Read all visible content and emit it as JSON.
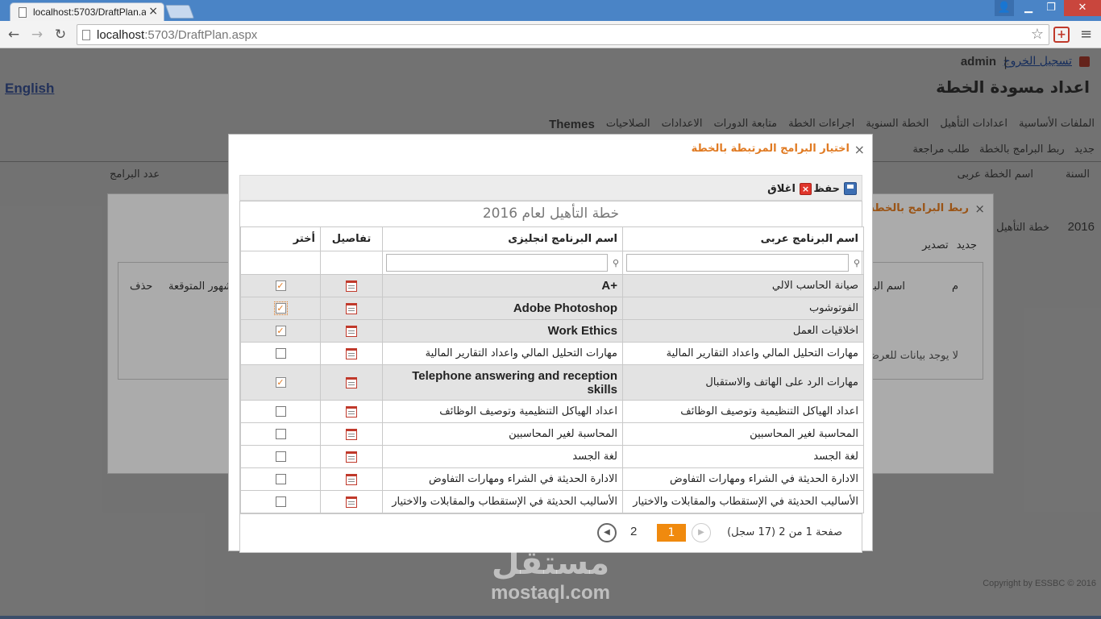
{
  "browser": {
    "tab_title": "localhost:5703/DraftPlan.a",
    "tab_close": "×",
    "url_host": "localhost",
    "url_rest": ":5703/DraftPlan.aspx",
    "win_min": "▁",
    "win_max": "❐",
    "win_close": "✕",
    "ext_label": "+"
  },
  "background_page": {
    "user": "admin",
    "separator": "|",
    "logout": "تسجيل الخروج",
    "english_link": "English",
    "title": "اعداد مسودة الخطة",
    "menu": [
      "الملفات الأساسية",
      "اعدادات التأهيل",
      "الخطة السنوية",
      "اجراءات الخطة",
      "متابعة الدورات",
      "الاعدادات",
      "الصلاحيات",
      "Themes"
    ],
    "toolbar": [
      "جديد",
      "ربط البرامج بالخطة",
      "طلب مراجعة"
    ],
    "grid_headers": [
      "السنة",
      "اسم الخطة عربى",
      "عدد البرامج"
    ],
    "row_year": "2016",
    "row_name": "خطة التأهيل ل",
    "copyright": "Copyright by ESSBC © 2016"
  },
  "middle_dialog": {
    "title": "ربط البرامج بالخطة",
    "toolbar": [
      "جديد",
      "تصدير"
    ],
    "headers": [
      "م",
      "اسم البر",
      "شهور المتوقعة",
      "حذف"
    ],
    "empty_text": "لا يوجد بيانات للعرض"
  },
  "modal": {
    "title": "اختيار البرامج المرتبطة بالخطة",
    "close": "×",
    "toolbar": {
      "save_label": "حفظ",
      "close_label": "اغلاق",
      "close_glyph": "×"
    },
    "caption": "خطة التأهيل لعام 2016",
    "columns": {
      "name_ar": "اسم البرنامج عربى",
      "name_en": "اسم البرنامج انجليزى",
      "details": "تفاصيل",
      "select": "أختر"
    },
    "rows": [
      {
        "name_ar": "صيانة الحاسب الالي",
        "name_en": "A+",
        "checked": true,
        "highlight": true
      },
      {
        "name_ar": "الفوتوشوب",
        "name_en": "Adobe Photoshop",
        "checked": true,
        "highlight": true,
        "focused": true
      },
      {
        "name_ar": "اخلاقيات العمل",
        "name_en": "Work Ethics",
        "checked": true,
        "highlight": true
      },
      {
        "name_ar": "مهارات التحليل المالي واعداد التقارير المالية",
        "name_en": "مهارات التحليل المالي واعداد التقارير المالية",
        "checked": false,
        "highlight": false
      },
      {
        "name_ar": "مهارات الرد على الهاتف والاستقبال",
        "name_en": "Telephone answering and reception skills",
        "checked": true,
        "highlight": true
      },
      {
        "name_ar": "اعداد الهياكل التنظيمية وتوصيف الوظائف",
        "name_en": "اعداد الهياكل التنظيمية وتوصيف الوظائف",
        "checked": false,
        "highlight": false
      },
      {
        "name_ar": "المحاسبة لغير المحاسبين",
        "name_en": "المحاسبة لغير المحاسبين",
        "checked": false,
        "highlight": false
      },
      {
        "name_ar": "لغة الجسد",
        "name_en": "لغة الجسد",
        "checked": false,
        "highlight": false
      },
      {
        "name_ar": "الادارة الحديثة في الشراء ومهارات التفاوض",
        "name_en": "الادارة الحديثة في الشراء ومهارات التفاوض",
        "checked": false,
        "highlight": false
      },
      {
        "name_ar": "الأساليب الحديثة في الإستقطاب والمقابلات والاختيار",
        "name_en": "الأساليب الحديثة في الإستقطاب والمقابلات والاختيار",
        "checked": false,
        "highlight": false
      }
    ],
    "pager": {
      "summary": "صفحة 1 من 2 (17 سجل)",
      "current_page": "1",
      "next_page": "2"
    }
  },
  "watermark": {
    "ar": "مستقل",
    "en": "mostaql.com"
  },
  "colors": {
    "accent": "#f08a0e",
    "title_orange": "#e07a22",
    "browser_blue": "#4a84c6"
  }
}
